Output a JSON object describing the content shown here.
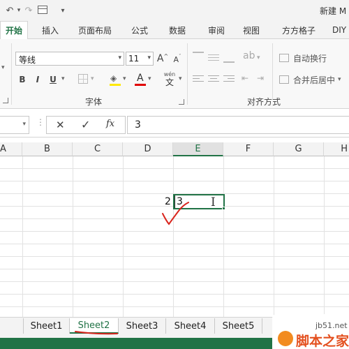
{
  "title": {
    "window": "新建 M"
  },
  "tabs": [
    {
      "label": "开始"
    },
    {
      "label": "插入"
    },
    {
      "label": "页面布局"
    },
    {
      "label": "公式"
    },
    {
      "label": "数据"
    },
    {
      "label": "审阅"
    },
    {
      "label": "视图"
    },
    {
      "label": "方方格子"
    },
    {
      "label": "DIY"
    }
  ],
  "ribbon": {
    "font_name": "等线",
    "font_size": "11",
    "grow_font": "A",
    "shrink_font": "A",
    "bold": "B",
    "italic": "I",
    "underline": "U",
    "font_color_letter": "A",
    "wen_top": "wén",
    "wen_bottom": "文",
    "font_group_label": "字体",
    "wrap_text": "自动换行",
    "merge_center": "合并后居中",
    "align_group_label": "对齐方式"
  },
  "formula_bar": {
    "cancel": "✕",
    "enter": "✓",
    "fx": "fx",
    "value": "3"
  },
  "columns": [
    {
      "label": "A"
    },
    {
      "label": "B"
    },
    {
      "label": "C"
    },
    {
      "label": "D"
    },
    {
      "label": "E"
    },
    {
      "label": "F"
    },
    {
      "label": "G"
    },
    {
      "label": "H"
    }
  ],
  "cells": {
    "d_value": "2",
    "e_value": "3"
  },
  "sheets": [
    {
      "label": "Sheet1"
    },
    {
      "label": "Sheet2"
    },
    {
      "label": "Sheet3"
    },
    {
      "label": "Sheet4"
    },
    {
      "label": "Sheet5"
    }
  ],
  "watermark": {
    "site": "jb51.net",
    "brand": "脚本之家"
  },
  "colors": {
    "excel_green": "#217346",
    "annotation_red": "#d9251d"
  }
}
